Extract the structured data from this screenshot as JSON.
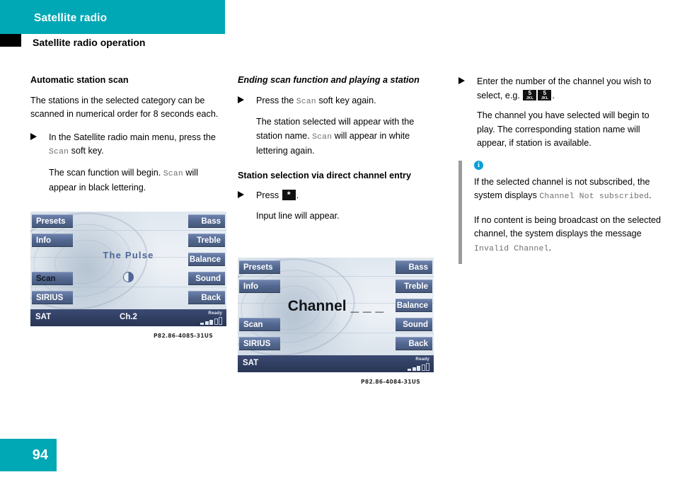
{
  "header": {
    "band_title": "Satellite radio",
    "section_title": "Satellite radio operation",
    "band_color": "#00a7b5"
  },
  "footer": {
    "page_number": "94"
  },
  "columns": {
    "left": {
      "heading": "Automatic station scan",
      "paragraph_1": "The stations in the selected category can be scanned in numerical order for 8 seconds each.",
      "bullet_1_pre": "In the Satellite radio main menu, press the ",
      "bullet_1_mono": "Scan",
      "bullet_1_post": " soft key.",
      "follow_1_pre": "The scan function will begin. ",
      "follow_1_mono": "Scan",
      "follow_1_post": " will appear in black lettering."
    },
    "middle": {
      "heading_1": "Ending scan function and playing a station",
      "bullet_1_pre": "Press the ",
      "bullet_1_mono": "Scan",
      "bullet_1_post": " soft key again.",
      "follow_1_pre": "The station selected will appear with the station name. ",
      "follow_1_mono": "Scan",
      "follow_1_post": " will appear in white lettering again.",
      "heading_2": "Station selection via direct channel entry",
      "bullet_2_pre": "Press ",
      "bullet_2_key": "*",
      "bullet_2_post": ".",
      "follow_2": "Input line will appear."
    },
    "right": {
      "bullet_1_pre": "Enter the number of the channel you wish to select, e.g. ",
      "bullet_1_key_num": "5",
      "bullet_1_key_sub": "JKL",
      "bullet_1_post": ".",
      "follow_1": "The channel you have selected will begin to play. The corresponding station name will appear, if station is available.",
      "note": {
        "icon": "info-icon",
        "line_1_pre": "If the selected channel is not subscribed, the system displays ",
        "line_1_mono": "Channel Not subscribed",
        "line_1_post": ".",
        "line_2_pre": "If no content is being broadcast on the selected channel, the system displays the message ",
        "line_2_mono": "Invalid Channel",
        "line_2_post": "."
      }
    }
  },
  "display_1": {
    "caption": "P82.86-4085-31US",
    "left_keys": [
      "Presets",
      "Info",
      "Scan",
      "SIRIUS"
    ],
    "right_keys": [
      "Bass",
      "Treble",
      "Balance",
      "Sound",
      "Back"
    ],
    "center_text": "The Pulse",
    "center_icon": "half-moon-icon",
    "status_left": "SAT",
    "status_center": "Ch.2",
    "status_ready": "Ready",
    "signal_bars_filled": 3,
    "signal_bars_total": 5,
    "scan_key_state": "black-lettering"
  },
  "display_2": {
    "caption": "P82.86-4084-31US",
    "left_keys": [
      "Presets",
      "Info",
      "Scan",
      "SIRIUS"
    ],
    "right_keys": [
      "Bass",
      "Treble",
      "Balance",
      "Sound",
      "Back"
    ],
    "center_text": "Channel _ _ _",
    "status_left": "SAT",
    "status_center": "",
    "status_ready": "Ready",
    "signal_bars_filled": 3,
    "signal_bars_total": 5,
    "scan_key_state": "white-lettering"
  }
}
